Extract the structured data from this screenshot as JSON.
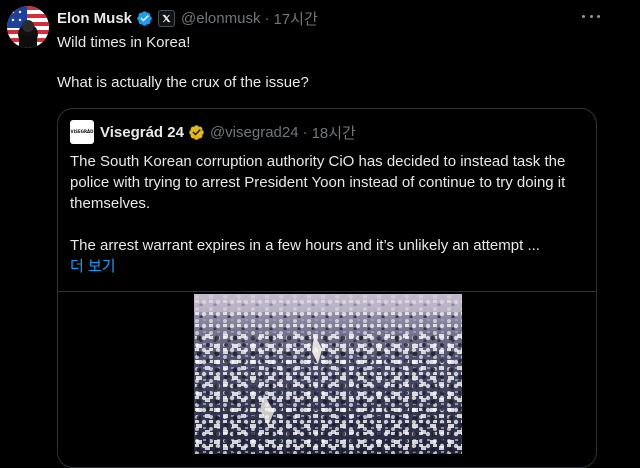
{
  "tweet": {
    "author_name": "Elon Musk",
    "handle": "@elonmusk",
    "separator": "·",
    "time": "17시간",
    "lines": [
      "Wild times in Korea!",
      "What is actually the crux of the issue?"
    ]
  },
  "quoted": {
    "author_name": "Visegrád 24",
    "handle": "@visegrad24",
    "separator": "·",
    "time": "18시간",
    "paragraphs": [
      "The South Korean corruption authority CiO has decided to instead task the police with trying to arrest President Yoon instead of continue to try doing it themselves.",
      "The arrest warrant expires in a few hours and it’s unlikely an attempt ..."
    ],
    "show_more": "더 보기"
  },
  "icons": {
    "avatar": "flag-avatar",
    "verified": "verified-badge-icon",
    "x": "x-logo-icon",
    "more": "more-dots-icon",
    "quoted_verified": "gold-verified-badge-icon"
  },
  "colors": {
    "background": "#000000",
    "text": "#e7e9ea",
    "muted": "#71767b",
    "link": "#1d9bf0",
    "blue_badge": "#1d9bf0",
    "gold_badge": "#e2b719",
    "border": "#2f3336"
  }
}
